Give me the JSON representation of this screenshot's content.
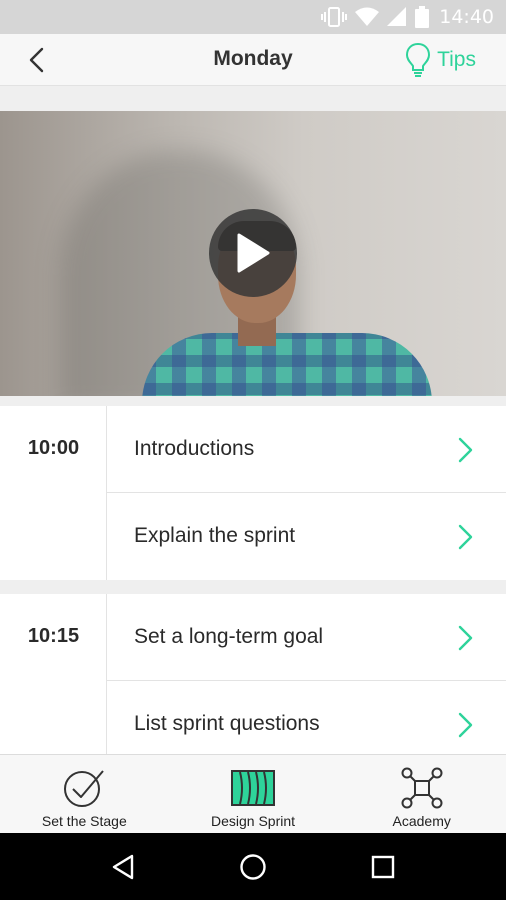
{
  "status_bar": {
    "time": "14:40"
  },
  "header": {
    "title": "Monday",
    "tips_label": "Tips"
  },
  "colors": {
    "accent": "#2ed39a",
    "text": "#2a2a2a",
    "status_bar": "#d6d6d6",
    "nav_bar": "#000000"
  },
  "schedule": [
    {
      "time": "10:00",
      "items": [
        {
          "label": "Introductions"
        },
        {
          "label": "Explain the sprint"
        }
      ]
    },
    {
      "time": "10:15",
      "items": [
        {
          "label": "Set a long-term goal"
        },
        {
          "label": "List sprint questions"
        }
      ]
    }
  ],
  "bottom_nav": [
    {
      "label": "Set the Stage",
      "icon": "check-circle-icon"
    },
    {
      "label": "Design Sprint",
      "icon": "sprint-waves-icon",
      "selected": true
    },
    {
      "label": "Academy",
      "icon": "network-icon"
    }
  ],
  "android_nav": {
    "back_icon": "triangle-back-icon",
    "home_icon": "circle-home-icon",
    "recents_icon": "square-recents-icon"
  }
}
